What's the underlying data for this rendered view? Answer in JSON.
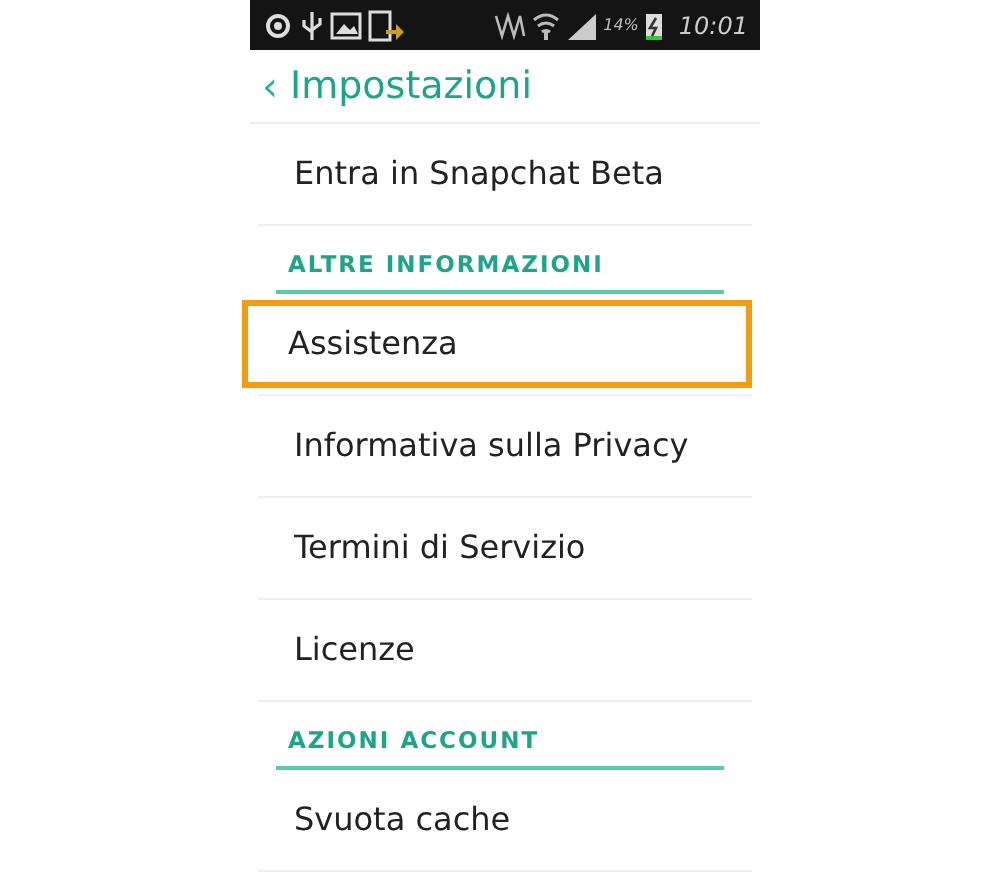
{
  "status_bar": {
    "battery": "14%",
    "time": "10:01"
  },
  "header": {
    "back": "‹",
    "title": "Impostazioni"
  },
  "list": [
    {
      "kind": "item",
      "label": "Entra in Snapchat Beta",
      "highlighted": false
    },
    {
      "kind": "section",
      "label": "ALTRE INFORMAZIONI"
    },
    {
      "kind": "item",
      "label": "Assistenza",
      "highlighted": true
    },
    {
      "kind": "item",
      "label": "Informativa sulla Privacy",
      "highlighted": false
    },
    {
      "kind": "item",
      "label": "Termini di Servizio",
      "highlighted": false
    },
    {
      "kind": "item",
      "label": "Licenze",
      "highlighted": false
    },
    {
      "kind": "section",
      "label": "AZIONI ACCOUNT"
    },
    {
      "kind": "item",
      "label": "Svuota cache",
      "highlighted": false
    }
  ]
}
